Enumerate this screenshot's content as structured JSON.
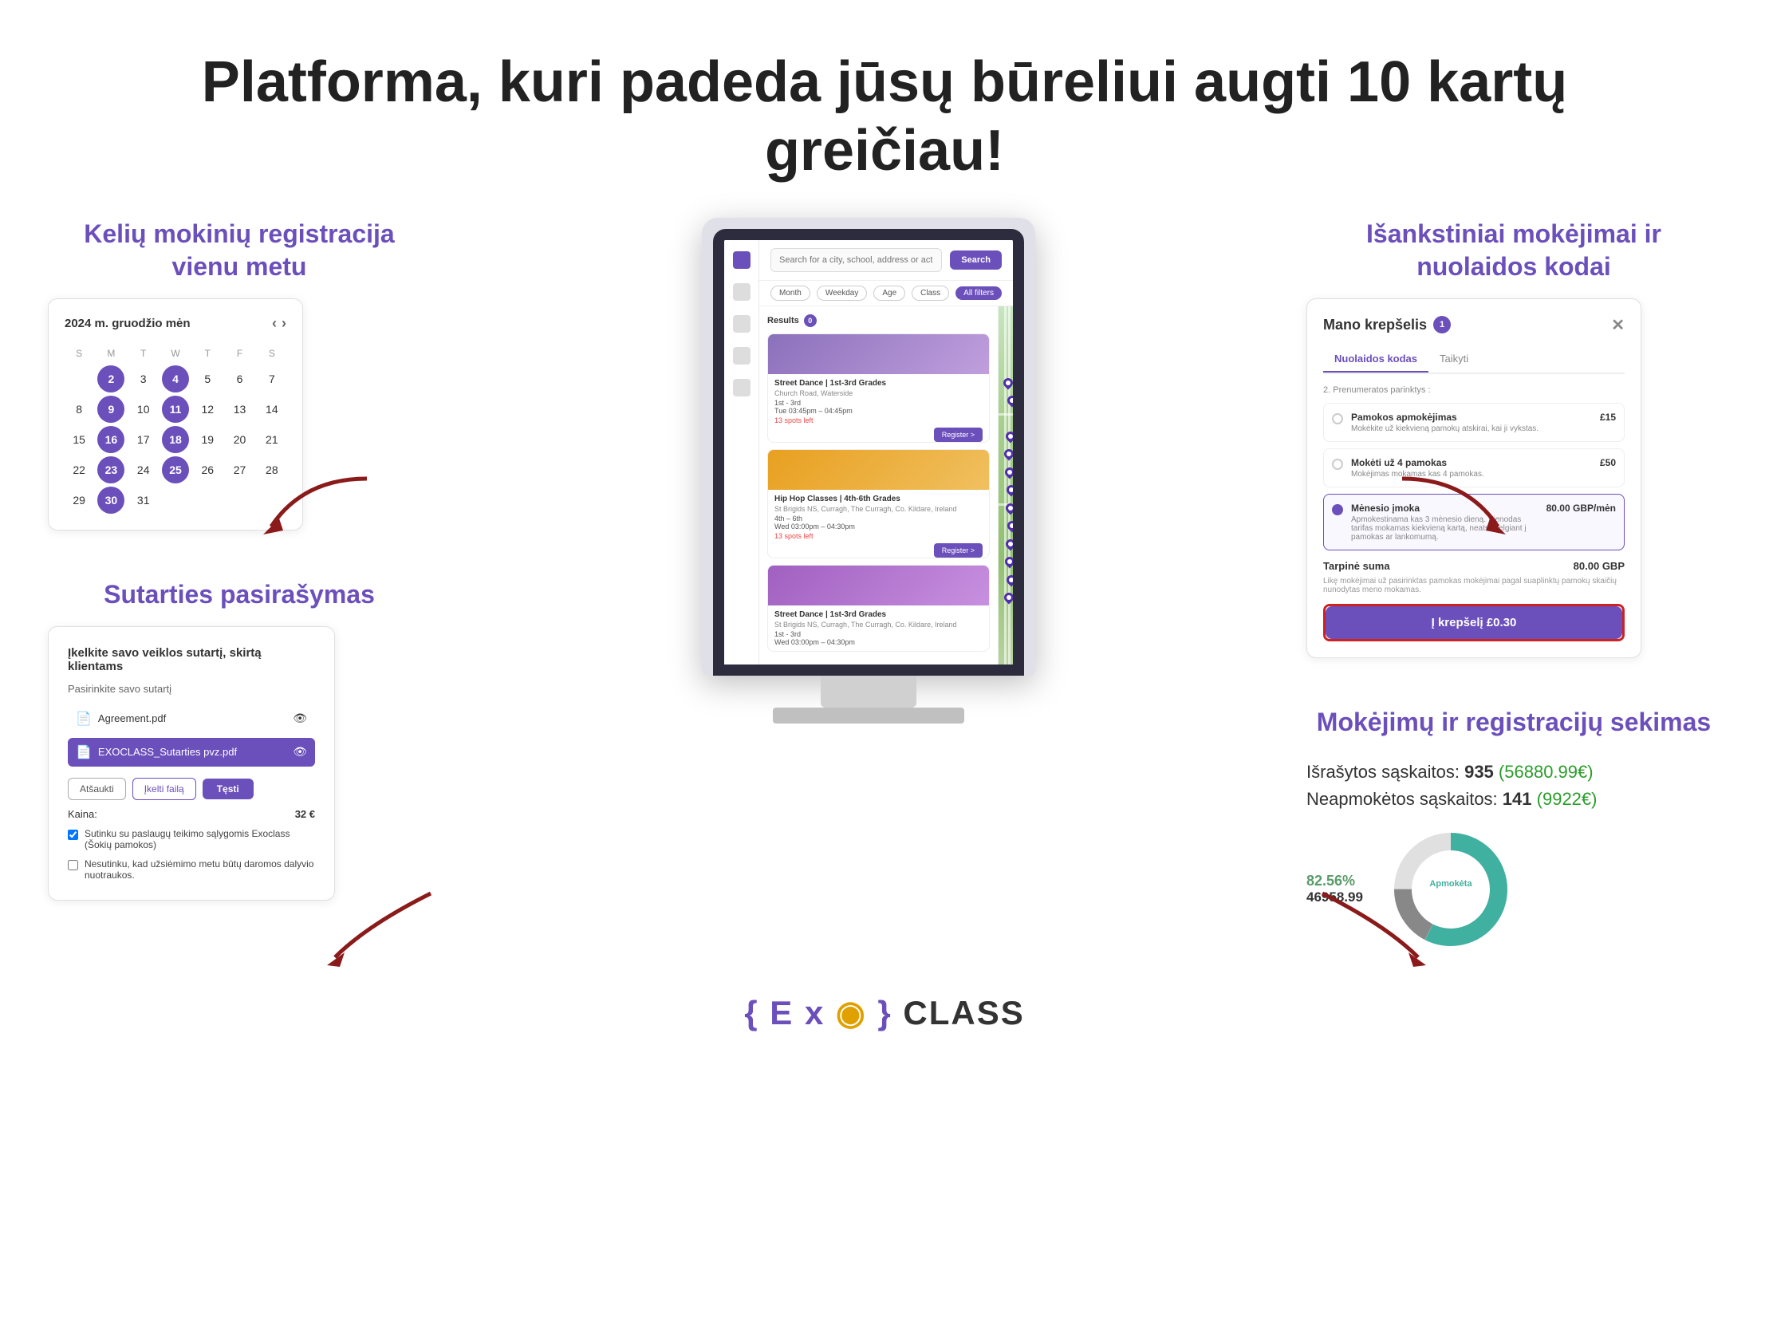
{
  "title": "Platforma, kuri padeda jūsų būreliui augti 10 kartų greičiau!",
  "sections": {
    "calendar": {
      "heading": "Kelių mokinių registracija vienu metu",
      "month": "2024 m. gruodžio mėn",
      "days_of_week": [
        "S",
        "M",
        "T",
        "W",
        "T",
        "F",
        "S"
      ],
      "weeks": [
        [
          "",
          "",
          "",
          "",
          "5",
          "6",
          "7"
        ],
        [
          "8",
          "9",
          "10",
          "11",
          "12",
          "13",
          "14"
        ],
        [
          "15",
          "16",
          "17",
          "18",
          "19",
          "20",
          "21"
        ],
        [
          "22",
          "23",
          "24",
          "25",
          "26",
          "27",
          "28"
        ],
        [
          "29",
          "30",
          "31",
          "",
          "",
          "",
          ""
        ]
      ],
      "highlighted": [
        "2",
        "4",
        "9",
        "11",
        "16",
        "18",
        "23",
        "25",
        "30"
      ]
    },
    "contract": {
      "heading": "Sutarties pasirašymas",
      "title": "Įkelkite savo veiklos sutartį, skirtą klientams",
      "subtitle": "Pasirinkite savo sutartį",
      "files": [
        {
          "name": "Agreement.pdf",
          "selected": false
        },
        {
          "name": "EXOCLASS_Sutarties pvz.pdf",
          "selected": true
        }
      ],
      "buttons": {
        "cancel": "Atšaukti",
        "upload": "Įkelti failą",
        "confirm": "Tęsti"
      },
      "price_label": "Kaina:",
      "price_value": "32 €",
      "checkbox1": "Sutinku su paslaugų teikimo sąlygomis Exoclass (Šokių pamokos)",
      "checkbox2": "Nesutinku, kad užsiėmimo metu būtų daromos dalyvio nuotraukos."
    },
    "cart": {
      "heading": "Išankstiniai mokėjimai ir nuolaidos kodai",
      "title": "Mano krepšelis",
      "badge": "1",
      "tabs": {
        "discount": "Nuolaidos kodas",
        "apply": "Taikyti"
      },
      "subscription_label": "2. Prenumeratos parinktys :",
      "options": [
        {
          "title": "Pamokos apmokėjimas",
          "desc": "Mokėkite už kiekvieną pamokų atskirai, kai ji vykstas.",
          "price": "£15",
          "selected": false
        },
        {
          "title": "Mokėti už 4 pamokas",
          "desc": "Mokėjimas mokamas kas 4 pamokas.",
          "price": "£50",
          "selected": false
        },
        {
          "title": "Mėnesio įmoka",
          "desc": "Apmokestinama kas 3 mėnesio dieną. Vienodas tarifas mokamas kiekvieną kartą, neatsižvelgiant į pamokas ar lankomumą.",
          "price": "80.00 GBP/mėn",
          "selected": true
        }
      ],
      "total_label": "Tarpinė suma",
      "total_value": "80.00 GBP",
      "note": "Likę mokėjimai už pasirinktas pamokas mokėjimai pagal suaplinktų pamokų skaičių nunodytas meno mokamas.",
      "cta": "Į krepšelį  £0.30"
    },
    "payments": {
      "heading": "Mokėjimų ir registracijų sekimas",
      "stat1_label": "Išrašytos sąskaitos:",
      "stat1_num": "935",
      "stat1_val": "(56880.99€)",
      "stat2_label": "Neapmokėtos sąskaitos:",
      "stat2_num": "141",
      "stat2_val": "(9922€)",
      "donut_pct": "82.56%",
      "donut_val": "46958.99",
      "donut_label": "Apmokėta",
      "donut_paid_pct": 82.56,
      "donut_unpaid_pct": 17.44
    },
    "search": {
      "placeholder": "Search for a city, school, address or activity",
      "search_btn": "Search",
      "filters": {
        "month": "Month",
        "weekday": "Weekday",
        "age": "Age",
        "class": "Class",
        "all_filters": "All filters"
      },
      "results_label": "Results",
      "results_count": "0",
      "cards": [
        {
          "title": "Street Dance | 1st-3rd Grades",
          "location": "Church Road, Waterside",
          "grades": "1st - 3rd",
          "time": "Tue 03:45pm – 04:45pm",
          "spots": "13 spots left",
          "register": "Register >"
        },
        {
          "title": "Hip Hop Classes | 4th-6th Grades",
          "location": "St Brigids NS, Curragh, The Curragh, Co. Kildare, Ireland",
          "grades": "4th – 6th",
          "time": "Wed 03:00pm – 04:30pm",
          "spots": "13 spots left",
          "register": "Register >"
        },
        {
          "title": "Street Dance | 1st-3rd Grades",
          "location": "St Brigids NS, Curragh, The Curragh, Co. Kildare, Ireland",
          "grades": "1st - 3rd",
          "time": "Wed 03:00pm – 04:30pm",
          "spots": "",
          "register": "Register >"
        }
      ]
    }
  },
  "logo": {
    "part1": "{",
    "part2": "E",
    "part3": "x",
    "part4": "◉",
    "part5": "}",
    "part6": "CLASS"
  },
  "colors": {
    "primary": "#6B4FBB",
    "accent_red": "#8B1A1A",
    "accent_green": "#2a9d2a",
    "teal": "#40b0a0"
  }
}
